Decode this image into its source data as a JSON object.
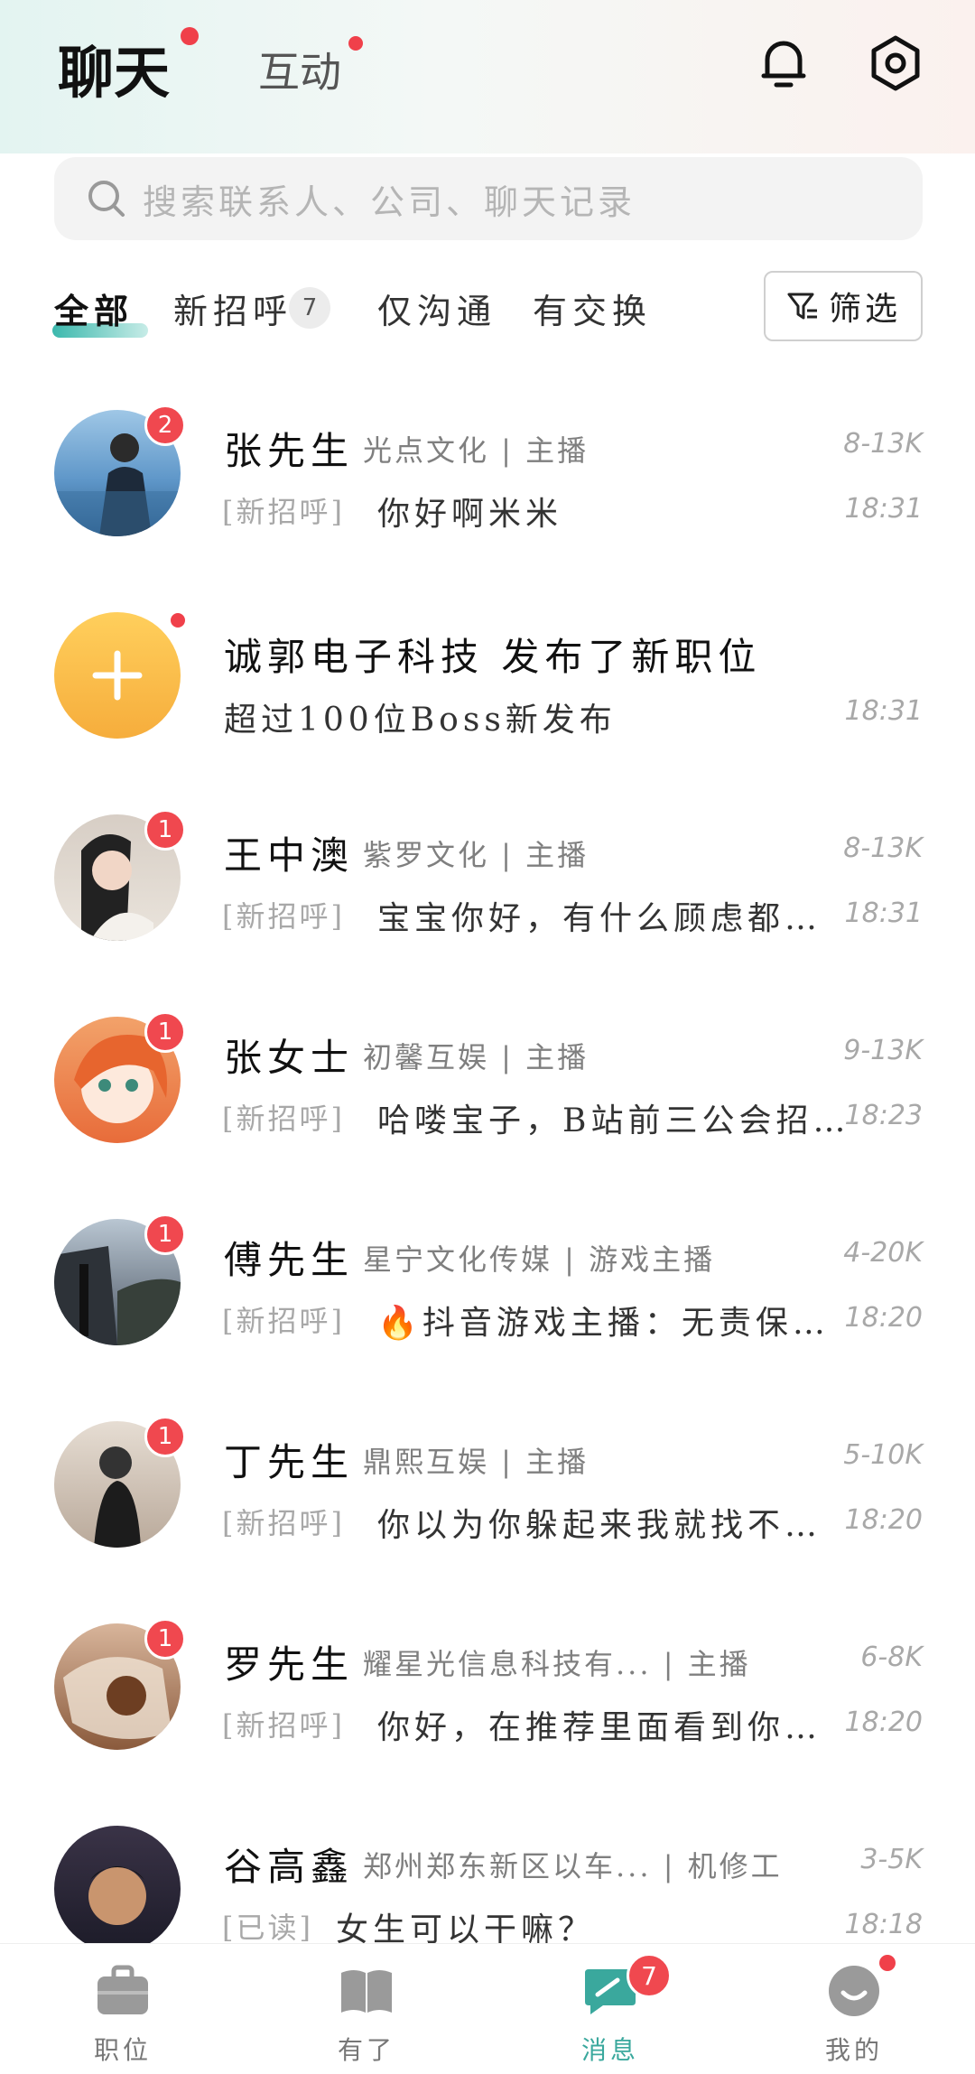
{
  "header": {
    "tab_chat": "聊天",
    "tab_interact": "互动"
  },
  "search": {
    "placeholder": "搜索联系人、公司、聊天记录"
  },
  "filters": {
    "all": "全部",
    "new_greet": "新招呼",
    "new_greet_count": "7",
    "only_chat": "仅沟通",
    "exchanged": "有交换",
    "filter_btn": "筛选"
  },
  "chats": [
    {
      "name": "张先生",
      "company": "光点文化 | 主播",
      "salary": "8-13K",
      "tag": "[新招呼]",
      "message": "你好啊米米",
      "time": "18:31",
      "unread": "2"
    },
    {
      "name": "诚郭电子科技 发布了新职位",
      "company": "",
      "salary": "",
      "tag": "",
      "message": "超过100位Boss新发布",
      "time": "18:31",
      "unread": ""
    },
    {
      "name": "王中澳",
      "company": "紫罗文化 | 主播",
      "salary": "8-13K",
      "tag": "[新招呼]",
      "message": "宝宝你好，有什么顾虑都可 ...",
      "time": "18:31",
      "unread": "1"
    },
    {
      "name": "张女士",
      "company": "初馨互娱 | 主播",
      "salary": "9-13K",
      "tag": "[新招呼]",
      "message": "哈喽宝子，B站前三公会招 ...",
      "time": "18:23",
      "unread": "1"
    },
    {
      "name": "傅先生",
      "company": "星宁文化传媒 | 游戏主播",
      "salary": "4-20K",
      "tag": "[新招呼]",
      "message": "🔥抖音游戏主播：无责保 ...",
      "time": "18:20",
      "unread": "1"
    },
    {
      "name": "丁先生",
      "company": "鼎熙互娱 | 主播",
      "salary": "5-10K",
      "tag": "[新招呼]",
      "message": "你以为你躲起来我就找不到 ...",
      "time": "18:20",
      "unread": "1"
    },
    {
      "name": "罗先生",
      "company": "耀星光信息科技有... | 主播",
      "salary": "6-8K",
      "tag": "[新招呼]",
      "message": "你好，在推荐里面看到你的 ...",
      "time": "18:20",
      "unread": "1"
    },
    {
      "name": "谷高鑫",
      "company": "郑州郑东新区以车... | 机修工",
      "salary": "3-5K",
      "tag": "[已读]",
      "message": "女生可以干嘛？",
      "time": "18:18",
      "unread": ""
    }
  ],
  "nav": {
    "jobs": "职位",
    "youle": "有了",
    "messages": "消息",
    "messages_badge": "7",
    "mine": "我的"
  },
  "colors": {
    "accent": "#3aa89d",
    "badge": "#f0484f"
  }
}
